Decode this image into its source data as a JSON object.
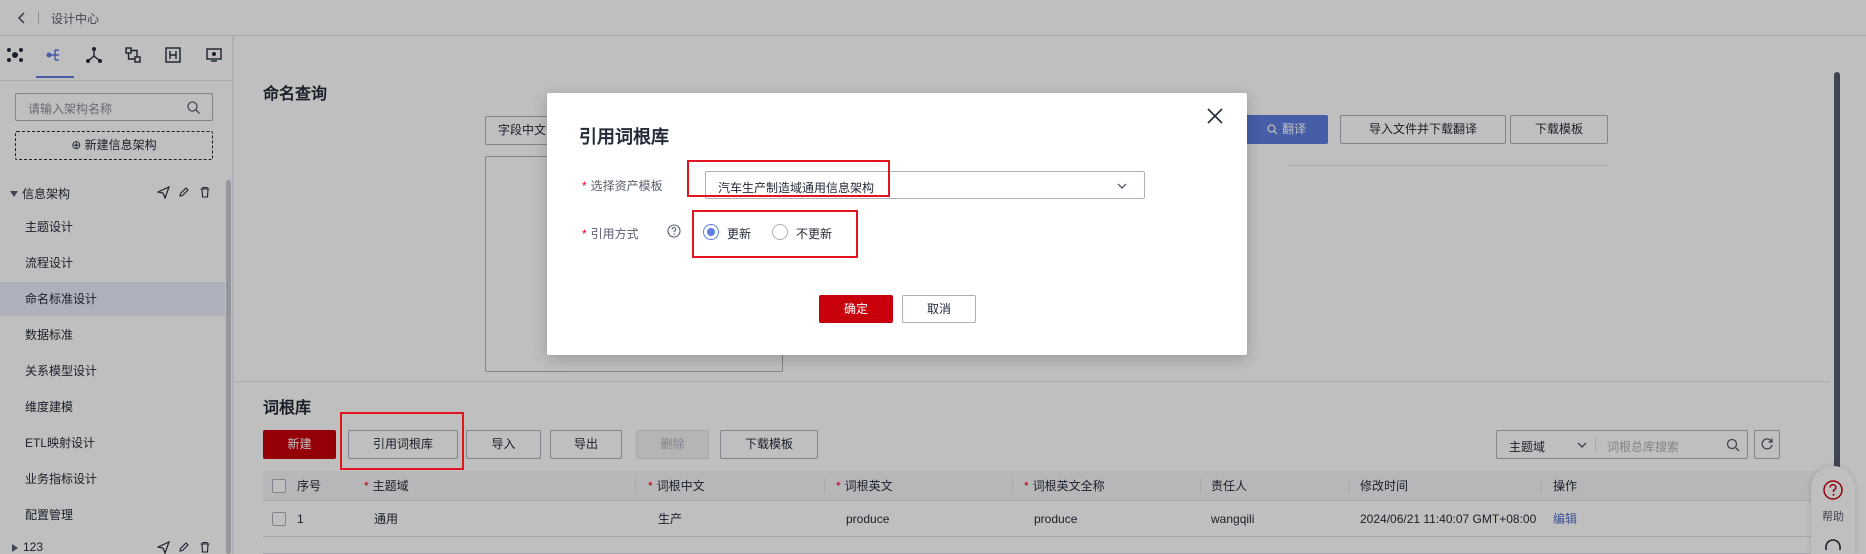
{
  "topbar": {
    "breadcrumb": "设计中心"
  },
  "sidebar": {
    "tool_icons": [
      "architecture-icon",
      "tree-icon",
      "hierarchy-icon",
      "model-icon",
      "flow-icon",
      "monitor-icon"
    ],
    "search_placeholder": "请输入架构名称",
    "new_button": "⊕ 新建信息架构",
    "group_label": "信息架构",
    "items": [
      "主题设计",
      "流程设计",
      "命名标准设计",
      "数据标准",
      "关系模型设计",
      "维度建模",
      "ETL映射设计",
      "业务指标设计",
      "配置管理"
    ],
    "active_index": 2,
    "group2_label": "123"
  },
  "main": {
    "query_title": "命名查询",
    "field_select": "字段中文",
    "translate_button": "翻译",
    "import_translate_button": "导入文件并下载翻译",
    "download_template_button": "下载模板",
    "lexicon_title": "词根库",
    "toolbar": {
      "new": "新建",
      "reference": "引用词根库",
      "import": "导入",
      "export": "导出",
      "delete": "删除",
      "download_template": "下载模板"
    },
    "domain_select": "主题域",
    "search_placeholder": "词根总库搜索",
    "table": {
      "headers": [
        "序号",
        "主题域",
        "词根中文",
        "词根英文",
        "词根英文全称",
        "责任人",
        "修改时间",
        "操作"
      ],
      "required": [
        false,
        true,
        true,
        true,
        true,
        false,
        false,
        false
      ],
      "rows": [
        {
          "no": "1",
          "domain": "通用",
          "cn": "生产",
          "en": "produce",
          "en_full": "produce",
          "owner": "wangqili",
          "modified": "2024/06/21 11:40:07 GMT+08:00",
          "action": "编辑"
        }
      ]
    }
  },
  "help": {
    "label": "帮助"
  },
  "dialog": {
    "title": "引用词根库",
    "template_label": "选择资产模板",
    "template_value": "汽车生产制造域通用信息架构",
    "mode_label": "引用方式",
    "options": [
      "更新",
      "不更新"
    ],
    "selected_option": 0,
    "confirm": "确定",
    "cancel": "取消"
  },
  "colors": {
    "brand_red": "#c7000b",
    "primary_blue": "#5e7ce0",
    "highlight_red": "#e0161f"
  }
}
